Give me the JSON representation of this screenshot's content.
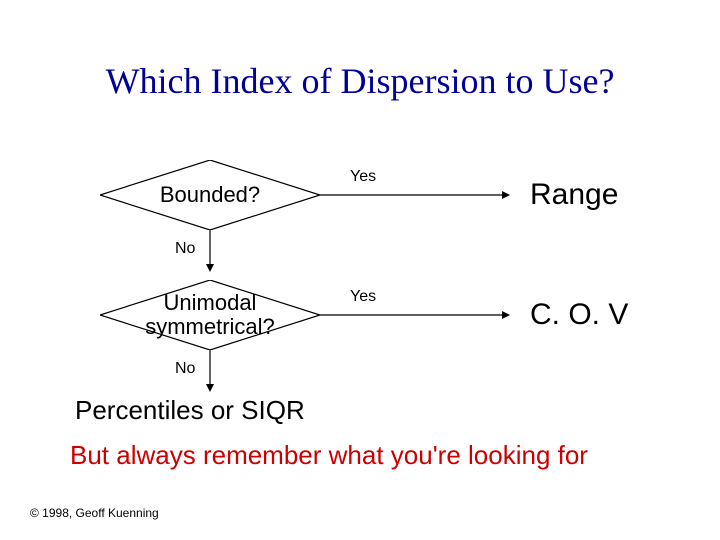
{
  "title": "Which Index of Dispersion to Use?",
  "decisions": {
    "d1": {
      "label": "Bounded?",
      "yes": "Yes",
      "no": "No",
      "outcome": "Range"
    },
    "d2": {
      "label": "Unimodal\nsymmetrical?",
      "yes": "Yes",
      "no": "No",
      "outcome": "C. O. V"
    }
  },
  "final": "Percentiles or SIQR",
  "note": "But always remember what you're looking for",
  "copyright": "© 1998, Geoff Kuenning"
}
